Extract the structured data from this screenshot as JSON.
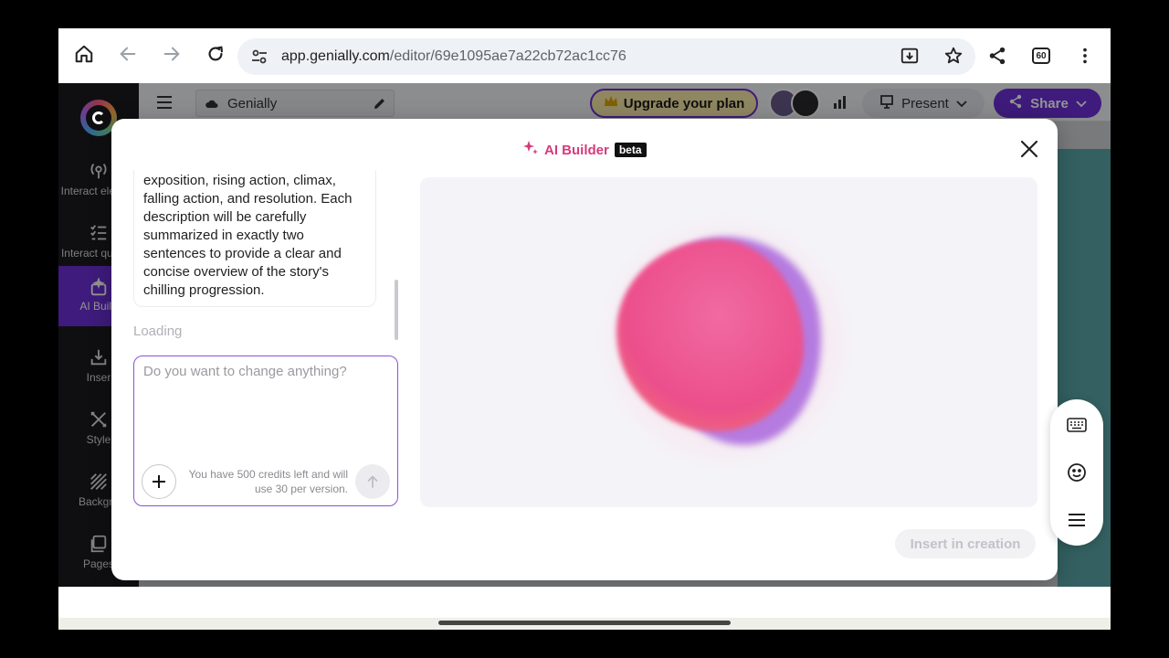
{
  "browser": {
    "url_domain": "app.genially.com",
    "url_path": "/editor/69e1095ae7a22cb72ac1cc76",
    "tab_count": "60"
  },
  "sidebar": {
    "items": [
      {
        "label": "Interact elemen"
      },
      {
        "label": "Interact questio"
      },
      {
        "label": "AI Build"
      },
      {
        "label": "Inser"
      },
      {
        "label": "Style"
      },
      {
        "label": "Backgro"
      },
      {
        "label": "Pages"
      }
    ]
  },
  "topbar": {
    "title": "Genially",
    "upgrade_label": "Upgrade your plan",
    "present_label": "Present",
    "share_label": "Share"
  },
  "modal": {
    "title": "AI Builder",
    "badge": "beta",
    "chat_message": "exposition, rising action, climax, falling action, and resolution. Each description will be carefully summarized in exactly two sentences to provide a clear and concise overview of the story's chilling progression.",
    "loading": "Loading",
    "composer_placeholder": "Do you want to change anything?",
    "credits_text": "You have 500 credits left and will use 30 per version.",
    "insert_label": "Insert in creation"
  },
  "colors": {
    "accent": "#6b2fd6",
    "ai_pink": "#d63a7a",
    "blob_pink": "#ec4f8c",
    "blob_purple": "#b57be0"
  },
  "icons": [
    "home-icon",
    "back-icon",
    "forward-icon",
    "reload-icon",
    "site-settings-icon",
    "download-icon",
    "star-icon",
    "share-icon",
    "more-icon",
    "menu-icon",
    "cloud-icon",
    "pencil-icon",
    "crown-icon",
    "avatar",
    "stats-icon",
    "present-icon",
    "sparkle-icon",
    "close-icon",
    "plus-icon",
    "send-icon",
    "keyboard-icon",
    "emoji-icon",
    "hamburger-icon"
  ]
}
